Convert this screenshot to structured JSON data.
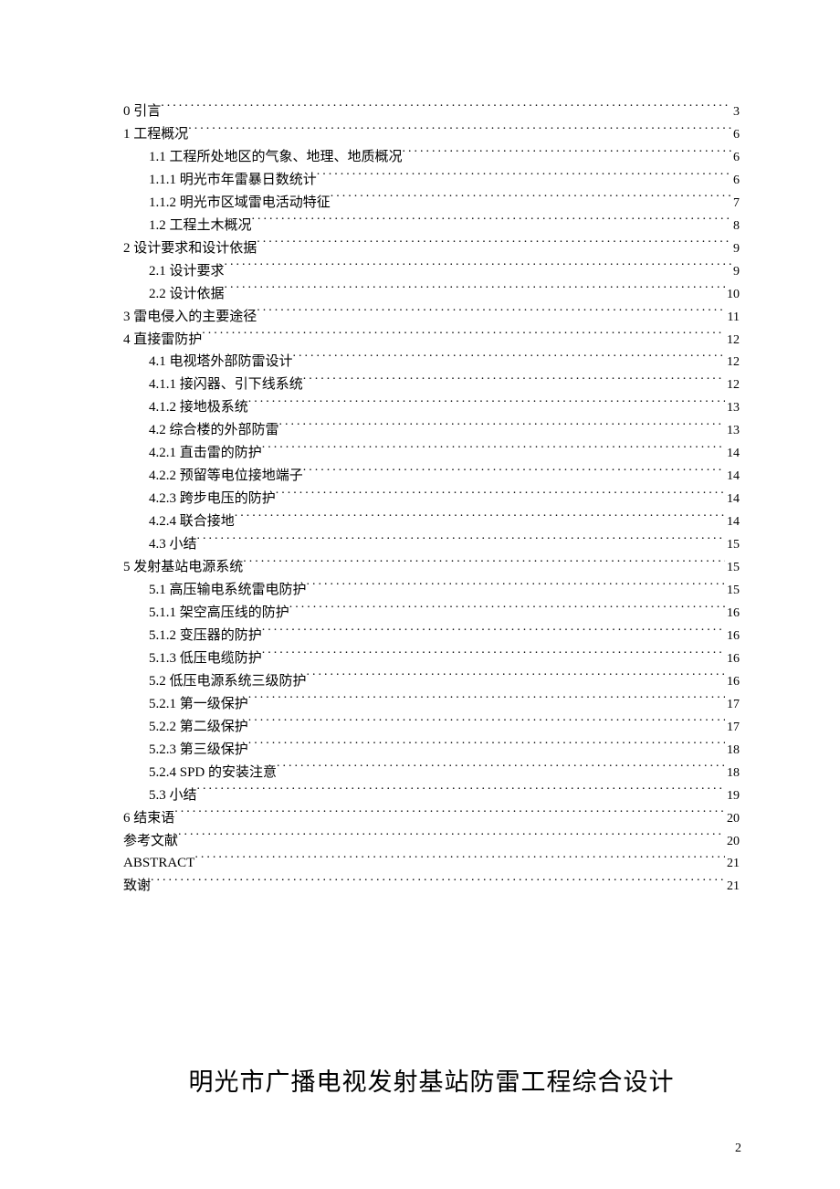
{
  "toc": [
    {
      "indent": 0,
      "title": "0  引言",
      "page": "3"
    },
    {
      "indent": 0,
      "title": "1  工程概况",
      "page": "6"
    },
    {
      "indent": 1,
      "title": "1.1  工程所处地区的气象、地理、地质概况",
      "page": "6"
    },
    {
      "indent": 1,
      "title": "1.1.1 明光市年雷暴日数统计",
      "page": "6"
    },
    {
      "indent": 1,
      "title": "1.1.2 明光市区域雷电活动特征",
      "page": "7"
    },
    {
      "indent": 1,
      "title": "1.2  工程土木概况",
      "page": "8"
    },
    {
      "indent": 0,
      "title": "2 设计要求和设计依据",
      "page": "9"
    },
    {
      "indent": 1,
      "title": "2.1 设计要求",
      "page": "9"
    },
    {
      "indent": 1,
      "title": "2.2 设计依据",
      "page": "10"
    },
    {
      "indent": 0,
      "title": "3  雷电侵入的主要途径",
      "page": "11"
    },
    {
      "indent": 0,
      "title": "4  直接雷防护",
      "page": "12"
    },
    {
      "indent": 1,
      "title": "4.1 电视塔外部防雷设计",
      "page": "12"
    },
    {
      "indent": 1,
      "title": "4.1.1 接闪器、引下线系统",
      "page": "12"
    },
    {
      "indent": 1,
      "title": "4.1.2 接地极系统",
      "page": "13"
    },
    {
      "indent": 1,
      "title": "4.2 综合楼的外部防雷",
      "page": "13"
    },
    {
      "indent": 1,
      "title": "4.2.1 直击雷的防护",
      "page": "14"
    },
    {
      "indent": 1,
      "title": "4.2.2 预留等电位接地端子",
      "page": "14"
    },
    {
      "indent": 1,
      "title": "4.2.3 跨步电压的防护",
      "page": "14"
    },
    {
      "indent": 1,
      "title": "4.2.4 联合接地",
      "page": "14"
    },
    {
      "indent": 1,
      "title": "4.3 小结",
      "page": "15"
    },
    {
      "indent": 0,
      "title": "5 发射基站电源系统",
      "page": "15"
    },
    {
      "indent": 1,
      "title": "5.1 高压输电系统雷电防护",
      "page": "15"
    },
    {
      "indent": 1,
      "title": "5.1.1 架空高压线的防护",
      "page": "16"
    },
    {
      "indent": 1,
      "title": "5.1.2 变压器的防护",
      "page": "16"
    },
    {
      "indent": 1,
      "title": "5.1.3 低压电缆防护",
      "page": "16"
    },
    {
      "indent": 1,
      "title": "5.2 低压电源系统三级防护",
      "page": "16"
    },
    {
      "indent": 1,
      "title": "5.2.1 第一级保护",
      "page": "17"
    },
    {
      "indent": 1,
      "title": "5.2.2 第二级保护",
      "page": "17"
    },
    {
      "indent": 1,
      "title": "5.2.3 第三级保护",
      "page": "18"
    },
    {
      "indent": 1,
      "title": "5.2.4  SPD 的安装注意",
      "page": "18"
    },
    {
      "indent": 1,
      "title": "5.3 小结",
      "page": "19"
    },
    {
      "indent": 0,
      "title": "6 结束语",
      "page": "20"
    },
    {
      "indent": 0,
      "title": "参考文献",
      "page": "20"
    },
    {
      "indent": 0,
      "title": "ABSTRACT",
      "latin": true,
      "page": "21"
    },
    {
      "indent": 0,
      "title": "致谢",
      "page": "21"
    }
  ],
  "doc_title": "明光市广播电视发射基站防雷工程综合设计",
  "page_number": "2"
}
